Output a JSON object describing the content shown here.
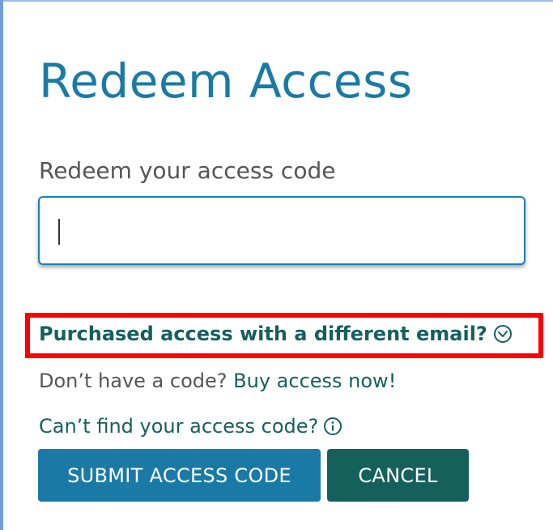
{
  "page": {
    "title": "Redeem Access",
    "accent_color": "#1a7aa5",
    "link_color": "#16605c"
  },
  "form": {
    "field_label": "Redeem your access code",
    "code_value": "",
    "code_placeholder": ""
  },
  "links": {
    "different_email": "Purchased access with a different email?",
    "different_email_icon": "clock-arrow-icon",
    "no_code_prefix": "Don’t have a code?",
    "buy_access": "Buy access now!",
    "cant_find": "Can’t find your access code?",
    "cant_find_icon": "info-icon"
  },
  "buttons": {
    "submit_label": "SUBMIT ACCESS CODE",
    "cancel_label": "CANCEL"
  }
}
